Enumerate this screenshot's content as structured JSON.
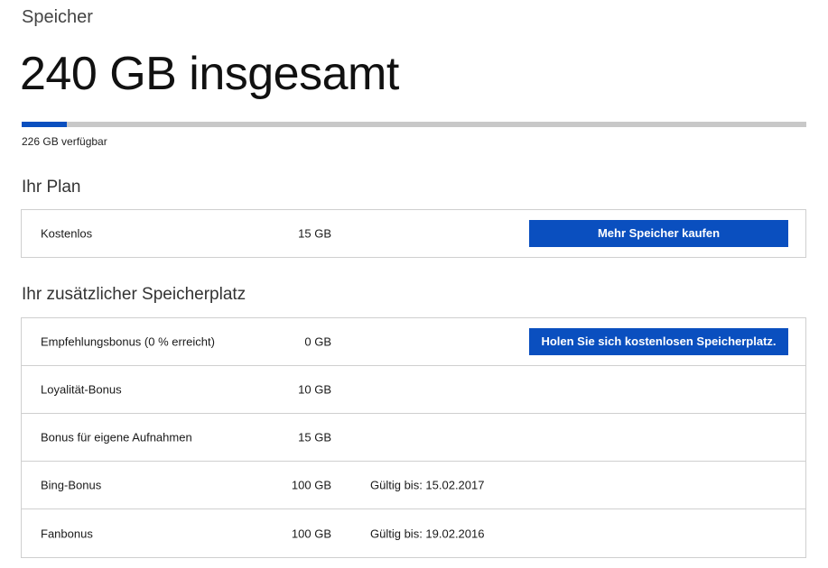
{
  "header": {
    "label": "Speicher",
    "total_title": "240 GB insgesamt"
  },
  "usage": {
    "used_fraction": 0.058,
    "available_text": "226 GB verfügbar",
    "fill_color": "#0a4fbf",
    "track_color": "#c8c8c8"
  },
  "plan": {
    "title": "Ihr Plan",
    "row": {
      "name": "Kostenlos",
      "size": "15 GB",
      "button_label": "Mehr Speicher kaufen"
    }
  },
  "extra": {
    "title": "Ihr zusätzlicher Speicherplatz",
    "rows": [
      {
        "name": "Empfehlungsbonus (0 % erreicht)",
        "size": "0 GB",
        "button_label": "Holen Sie sich kostenlosen Speicherplatz."
      },
      {
        "name": "Loyalität-Bonus",
        "size": "10 GB"
      },
      {
        "name": "Bonus für eigene Aufnahmen",
        "size": "15 GB"
      },
      {
        "name": "Bing-Bonus",
        "size": "100 GB",
        "valid": "Gültig bis: 15.02.2017"
      },
      {
        "name": "Fanbonus",
        "size": "100 GB",
        "valid": "Gültig bis: 19.02.2016"
      }
    ]
  },
  "colors": {
    "accent": "#0a4fbf"
  }
}
